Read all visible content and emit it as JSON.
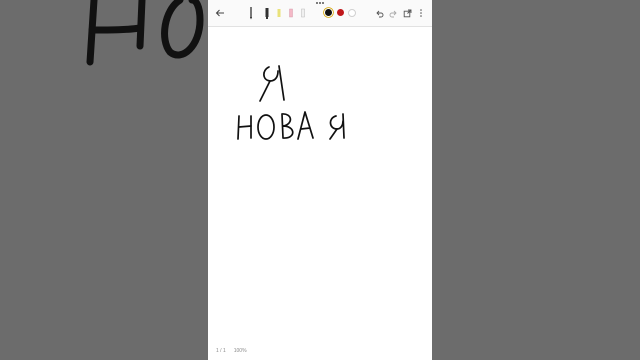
{
  "status": {
    "page_indicator": "1 / 1",
    "zoom_level": "100%"
  },
  "colors": {
    "background": "#6c6c6c",
    "ink": "#111111",
    "swatch_black": "#111111",
    "swatch_red": "#c0171a",
    "swatch_white": "#ffffff"
  },
  "icons": [
    "back-arrow-icon",
    "pen-tool-icon",
    "marker-tool-icon",
    "highlighter-tool-icon",
    "eraser-tool-icon",
    "ruler-tool-icon",
    "undo-icon",
    "redo-icon",
    "share-icon",
    "more-icon"
  ],
  "handwriting": {
    "line1": "Я",
    "line2": "НОВАЯ",
    "background_partial": "НО"
  }
}
